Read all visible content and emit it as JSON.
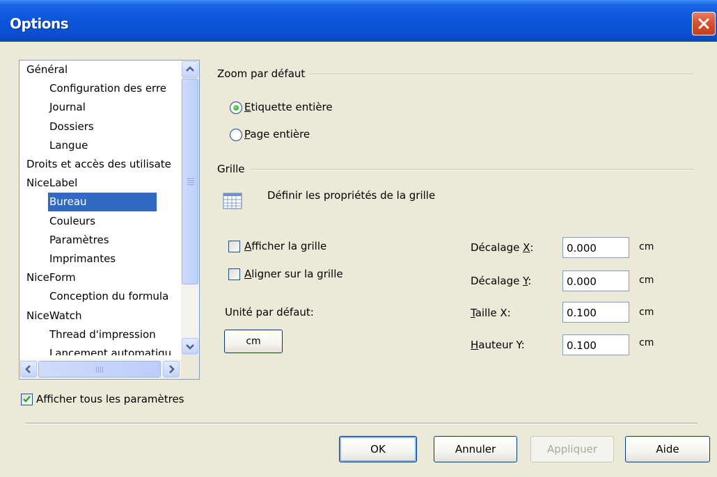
{
  "window": {
    "title": "Options"
  },
  "tree": {
    "items": [
      {
        "label": "Général",
        "level": 0,
        "selected": false
      },
      {
        "label": "Configuration des erre",
        "level": 1,
        "selected": false
      },
      {
        "label": "Journal",
        "level": 1,
        "selected": false
      },
      {
        "label": "Dossiers",
        "level": 1,
        "selected": false
      },
      {
        "label": "Langue",
        "level": 1,
        "selected": false
      },
      {
        "label": "Droits et accès des utilisate",
        "level": 0,
        "selected": false
      },
      {
        "label": "NiceLabel",
        "level": 0,
        "selected": false
      },
      {
        "label": "Bureau",
        "level": 1,
        "selected": true
      },
      {
        "label": "Couleurs",
        "level": 1,
        "selected": false
      },
      {
        "label": "Paramètres",
        "level": 1,
        "selected": false
      },
      {
        "label": "Imprimantes",
        "level": 1,
        "selected": false
      },
      {
        "label": "NiceForm",
        "level": 0,
        "selected": false
      },
      {
        "label": "Conception du formula",
        "level": 1,
        "selected": false
      },
      {
        "label": "NiceWatch",
        "level": 0,
        "selected": false
      },
      {
        "label": "Thread d'impression",
        "level": 1,
        "selected": false
      },
      {
        "label": "Lancement automatiqu",
        "level": 1,
        "selected": false
      }
    ]
  },
  "show_all": {
    "label": "Afficher tous les paramètres",
    "checked": true
  },
  "zoom": {
    "label": "Zoom par défaut",
    "options": [
      {
        "mnemonic": "E",
        "rest": "tiquette entière",
        "selected": true
      },
      {
        "mnemonic": "P",
        "rest": "age entière",
        "selected": false
      }
    ]
  },
  "grid": {
    "label": "Grille",
    "properties_text": "Définir les propriétés de la grille",
    "show": {
      "before": "",
      "mnemonic": "A",
      "after": "fficher la grille",
      "checked": false
    },
    "align": {
      "before": "",
      "mnemonic": "A",
      "after": "ligner sur la grille",
      "checked": false
    },
    "default_unit_label": "Unité par défaut:",
    "default_unit_button": "cm",
    "fields": [
      {
        "before": "Décalage ",
        "mnemonic": "X",
        "after": ":",
        "value": "0.000",
        "unit": "cm"
      },
      {
        "before": "Décalage ",
        "mnemonic": "Y",
        "after": ":",
        "value": "0.000",
        "unit": "cm"
      },
      {
        "before": "",
        "mnemonic": "T",
        "after": "aille X:",
        "value": "0.100",
        "unit": "cm"
      },
      {
        "before": "",
        "mnemonic": "H",
        "after": "auteur Y:",
        "value": "0.100",
        "unit": "cm"
      }
    ]
  },
  "buttons": {
    "ok": "OK",
    "cancel": "Annuler",
    "apply": "Appliquer",
    "help": "Aide"
  },
  "colors": {
    "titlebar": "#0a55dc",
    "selection": "#316ac5",
    "dialog_bg": "#ece9d8",
    "close": "#d8512e"
  }
}
